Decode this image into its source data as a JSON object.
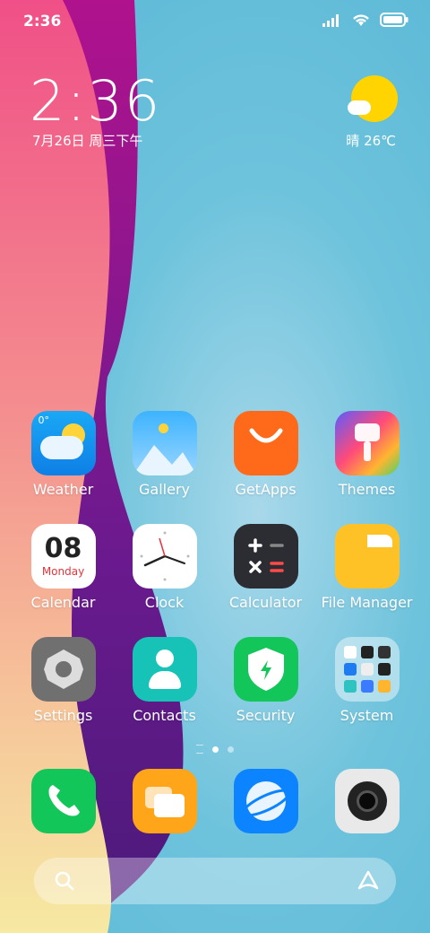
{
  "status": {
    "time": "2:36"
  },
  "lock": {
    "time": "2:36",
    "date": "7月26日 周三下午",
    "weather": "晴 26℃"
  },
  "apps": [
    {
      "label": "Weather",
      "badge": "0°"
    },
    {
      "label": "Gallery"
    },
    {
      "label": "GetApps"
    },
    {
      "label": "Themes"
    },
    {
      "label": "Calendar",
      "day": "08",
      "weekday": "Monday"
    },
    {
      "label": "Clock"
    },
    {
      "label": "Calculator"
    },
    {
      "label": "File Manager"
    },
    {
      "label": "Settings"
    },
    {
      "label": "Contacts"
    },
    {
      "label": "Security"
    },
    {
      "label": "System"
    }
  ],
  "dock": [
    "phone-icon",
    "messaging-icon",
    "browser-icon",
    "camera-icon"
  ],
  "colors": {
    "accent_blue": "#0d84ff",
    "green": "#13c65a",
    "orange": "#ff6a1a",
    "yellow": "#ffc226"
  }
}
